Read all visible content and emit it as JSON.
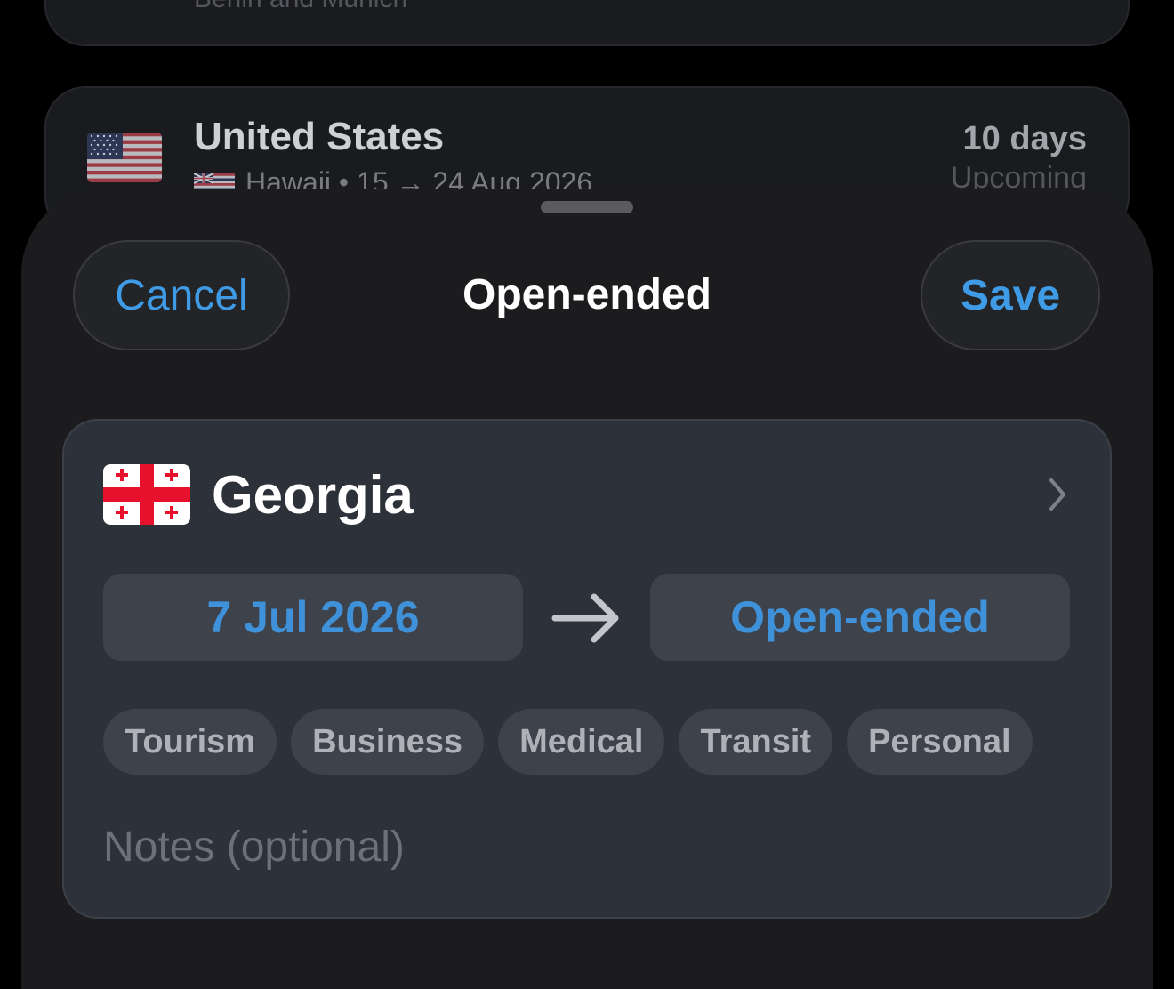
{
  "trips": {
    "prev_subtitle": "Berlin and Munich",
    "us": {
      "country": "United States",
      "flag_icon": "us-flag",
      "region_flag_icon": "hawaii-flag",
      "subtitle": "Hawaii • 15 → 24 Aug 2026",
      "duration": "10 days",
      "status": "Upcoming"
    }
  },
  "sheet": {
    "title": "Open-ended",
    "cancel_label": "Cancel",
    "save_label": "Save"
  },
  "form": {
    "country": "Georgia",
    "flag_icon": "georgia-flag",
    "start_date": "7 Jul 2026",
    "end_date": "Open-ended",
    "purposes": [
      "Tourism",
      "Business",
      "Medical",
      "Transit",
      "Personal"
    ],
    "notes_placeholder": "Notes (optional)"
  },
  "colors": {
    "accent": "#3f91d9",
    "background": "#000000",
    "sheet": "#1c1c1e",
    "card": "#2d3139"
  }
}
